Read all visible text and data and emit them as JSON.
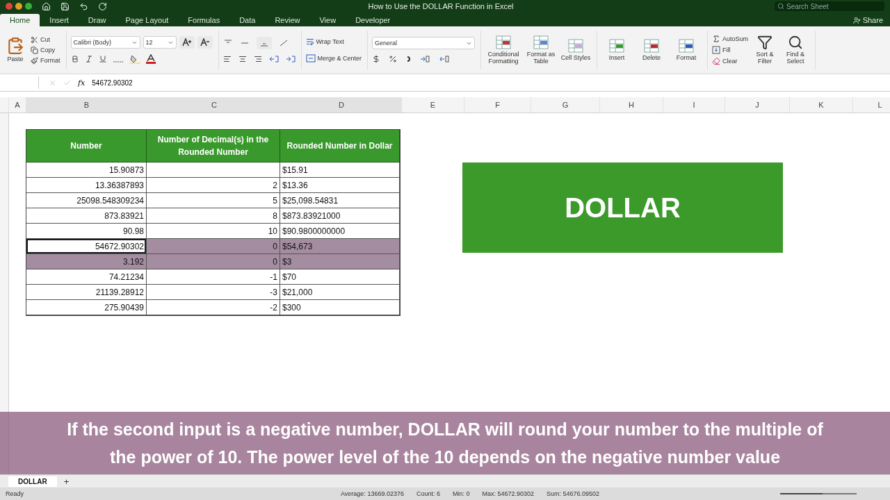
{
  "window": {
    "title": "How to Use the DOLLAR Function in Excel"
  },
  "search": {
    "placeholder": "Search Sheet"
  },
  "share": "Share",
  "ribbon_tabs": [
    {
      "label": "Home",
      "selected": true
    },
    {
      "label": "Insert",
      "selected": false
    },
    {
      "label": "Draw",
      "selected": false
    },
    {
      "label": "Page Layout",
      "selected": false
    },
    {
      "label": "Formulas",
      "selected": false
    },
    {
      "label": "Data",
      "selected": false
    },
    {
      "label": "Review",
      "selected": false
    },
    {
      "label": "View",
      "selected": false
    },
    {
      "label": "Developer",
      "selected": false
    }
  ],
  "clipboard": {
    "paste": "Paste",
    "cut": "Cut",
    "copy": "Copy",
    "format": "Format"
  },
  "font": {
    "name": "Calibri (Body)",
    "size": "12"
  },
  "alignment": {
    "wrap": "Wrap Text",
    "merge": "Merge & Center"
  },
  "number": {
    "format": "General"
  },
  "styles": [
    "Conditional Formatting",
    "Format as Table",
    "Cell Styles"
  ],
  "cells": [
    "Insert",
    "Delete",
    "Format"
  ],
  "editing": {
    "autosum": "AutoSum",
    "fill": "Fill",
    "clear": "Clear",
    "sort": "Sort & Filter",
    "find": "Find & Select"
  },
  "formula_bar": {
    "label": "fx",
    "value": "54672.90302"
  },
  "columns": [
    "A",
    "B",
    "C",
    "D",
    "E",
    "F",
    "G",
    "H",
    "I",
    "J",
    "K",
    "L"
  ],
  "table": {
    "headers": [
      "Number",
      "Number of Decimal(s) in the Rounded Number",
      "Rounded Number in Dollar"
    ],
    "rows": [
      {
        "number": "15.90873",
        "decimals": "",
        "dollar": "$15.91",
        "selected": false,
        "active": false
      },
      {
        "number": "13.36387893",
        "decimals": "2",
        "dollar": "$13.36",
        "selected": false,
        "active": false
      },
      {
        "number": "25098.548309234",
        "decimals": "5",
        "dollar": "$25,098.54831",
        "selected": false,
        "active": false
      },
      {
        "number": "873.83921",
        "decimals": "8",
        "dollar": "$873.83921000",
        "selected": false,
        "active": false
      },
      {
        "number": "90.98",
        "decimals": "10",
        "dollar": "$90.9800000000",
        "selected": false,
        "active": false
      },
      {
        "number": "54672.90302",
        "decimals": "0",
        "dollar": "$54,673",
        "selected": true,
        "active": true
      },
      {
        "number": "3.192",
        "decimals": "0",
        "dollar": "$3",
        "selected": true,
        "active": false
      },
      {
        "number": "74.21234",
        "decimals": "-1",
        "dollar": "$70",
        "selected": false,
        "active": false
      },
      {
        "number": "21139.28912",
        "decimals": "-3",
        "dollar": "$21,000",
        "selected": false,
        "active": false
      },
      {
        "number": "275.90439",
        "decimals": "-2",
        "dollar": "$300",
        "selected": false,
        "active": false
      }
    ]
  },
  "banner": "DOLLAR",
  "sheet_tabs": [
    {
      "label": "DOLLAR",
      "selected": true
    }
  ],
  "sheet_add": "+",
  "status_bar": {
    "mode": "Ready",
    "stats": [
      "Average: 13669.02376",
      "Count: 6",
      "Min: 0",
      "Max: 54672.90302",
      "Sum: 54676.09502"
    ]
  },
  "zoom": {
    "level": 0.55
  },
  "caption": "If the second input is a negative number, DOLLAR will round your number to the multiple of the power of 10. The power level of the 10 depends on the negative number value"
}
